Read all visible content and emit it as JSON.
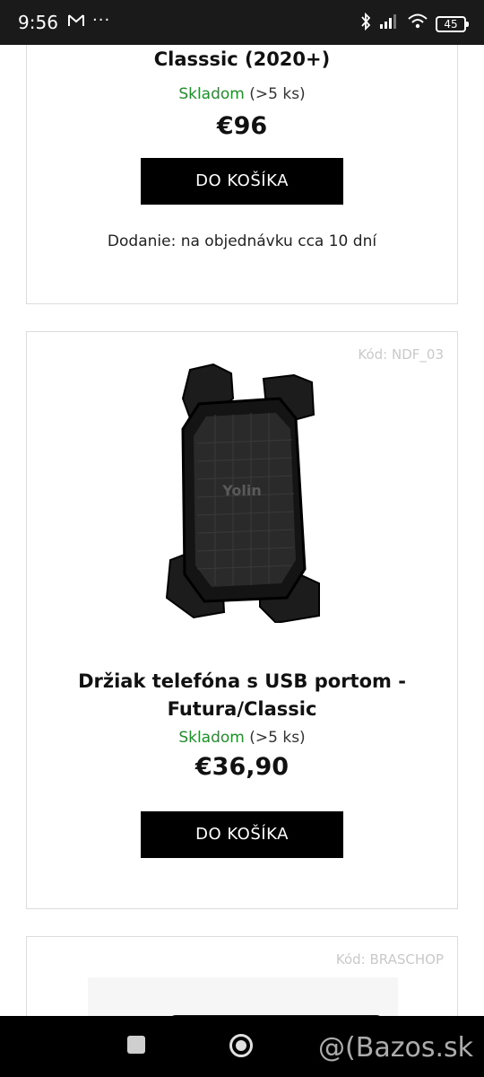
{
  "status_bar": {
    "time": "9:56",
    "gmail_icon": "gmail-icon",
    "more": "···",
    "battery": "45"
  },
  "products": [
    {
      "title": "Classsic (2020+)",
      "stock_status": "Skladom",
      "stock_qty": "(>5 ks)",
      "price": "€96",
      "button": "DO KOŠÍKA",
      "delivery": "Dodanie: na objednávku cca 10 dní"
    },
    {
      "code": "Kód: NDF_03",
      "brand_on_image": "Yolin",
      "title_line1": "Držiak telefóna s USB portom -",
      "title_line2": "Futura/Classic",
      "stock_status": "Skladom",
      "stock_qty": "(>5 ks)",
      "price": "€36,90",
      "button": "DO KOŠÍKA"
    },
    {
      "code": "Kód: BRASCHOP"
    }
  ],
  "nav": {
    "watermark": "@(Bazos.sk"
  },
  "colors": {
    "in_stock": "#1f8f2a",
    "button_bg": "#000000",
    "code_text": "#c9c9c9"
  }
}
